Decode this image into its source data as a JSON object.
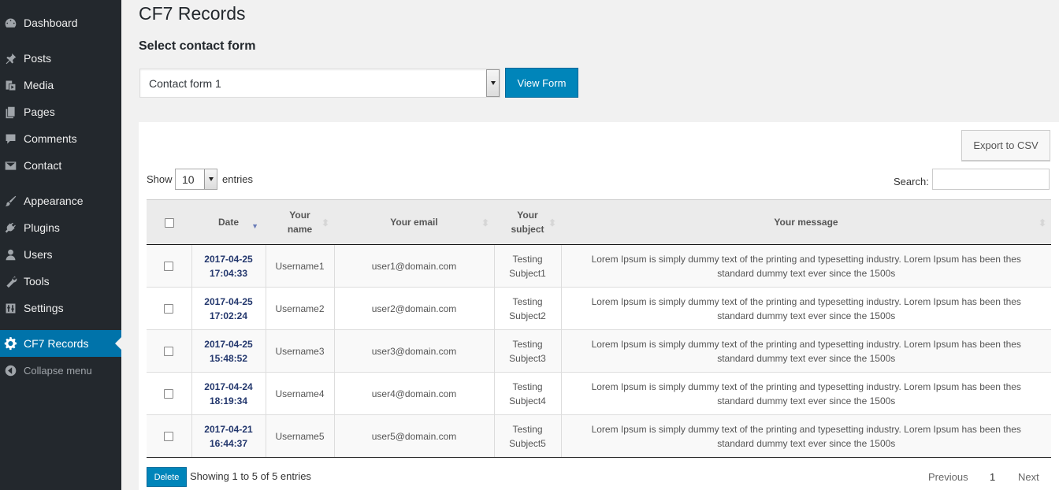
{
  "sidebar": {
    "items": [
      {
        "label": "Dashboard",
        "icon": "dashboard-icon"
      },
      {
        "label": "Posts",
        "icon": "pin-icon"
      },
      {
        "label": "Media",
        "icon": "media-icon"
      },
      {
        "label": "Pages",
        "icon": "pages-icon"
      },
      {
        "label": "Comments",
        "icon": "comment-icon"
      },
      {
        "label": "Contact",
        "icon": "envelope-icon"
      },
      {
        "label": "Appearance",
        "icon": "brush-icon"
      },
      {
        "label": "Plugins",
        "icon": "plug-icon"
      },
      {
        "label": "Users",
        "icon": "user-icon"
      },
      {
        "label": "Tools",
        "icon": "wrench-icon"
      },
      {
        "label": "Settings",
        "icon": "sliders-icon"
      },
      {
        "label": "CF7 Records",
        "icon": "gear-icon",
        "active": true
      },
      {
        "label": "Collapse menu",
        "icon": "collapse-icon"
      }
    ]
  },
  "page": {
    "title": "CF7 Records",
    "section_title": "Select contact form",
    "form_select_value": "Contact form 1",
    "view_form_label": "View Form",
    "export_label": "Export to CSV"
  },
  "table_controls": {
    "show_label": "Show",
    "length_value": "10",
    "entries_label": "entries",
    "search_label": "Search:"
  },
  "table": {
    "columns": [
      "Date",
      "Your name",
      "Your email",
      "Your subject",
      "Your message"
    ],
    "rows": [
      {
        "date": "2017-04-25",
        "time": "17:04:33",
        "name": "Username1",
        "email": "user1@domain.com",
        "subject_1": "Testing",
        "subject_2": "Subject1",
        "message": "Lorem Ipsum is simply dummy text of the printing and typesetting industry. Lorem Ipsum has been thes standard dummy text ever since the 1500s"
      },
      {
        "date": "2017-04-25",
        "time": "17:02:24",
        "name": "Username2",
        "email": "user2@domain.com",
        "subject_1": "Testing",
        "subject_2": "Subject2",
        "message": "Lorem Ipsum is simply dummy text of the printing and typesetting industry. Lorem Ipsum has been thes standard dummy text ever since the 1500s"
      },
      {
        "date": "2017-04-25",
        "time": "15:48:52",
        "name": "Username3",
        "email": "user3@domain.com",
        "subject_1": "Testing",
        "subject_2": "Subject3",
        "message": "Lorem Ipsum is simply dummy text of the printing and typesetting industry. Lorem Ipsum has been thes standard dummy text ever since the 1500s"
      },
      {
        "date": "2017-04-24",
        "time": "18:19:34",
        "name": "Username4",
        "email": "user4@domain.com",
        "subject_1": "Testing",
        "subject_2": "Subject4",
        "message": "Lorem Ipsum is simply dummy text of the printing and typesetting industry. Lorem Ipsum has been thes standard dummy text ever since the 1500s"
      },
      {
        "date": "2017-04-21",
        "time": "16:44:37",
        "name": "Username5",
        "email": "user5@domain.com",
        "subject_1": "Testing",
        "subject_2": "Subject5",
        "message": "Lorem Ipsum is simply dummy text of the printing and typesetting industry. Lorem Ipsum has been thes standard dummy text ever since the 1500s"
      }
    ]
  },
  "footer": {
    "delete_label": "Delete",
    "info": "Showing 1 to 5 of 5 entries",
    "previous": "Previous",
    "page": "1",
    "next": "Next"
  }
}
